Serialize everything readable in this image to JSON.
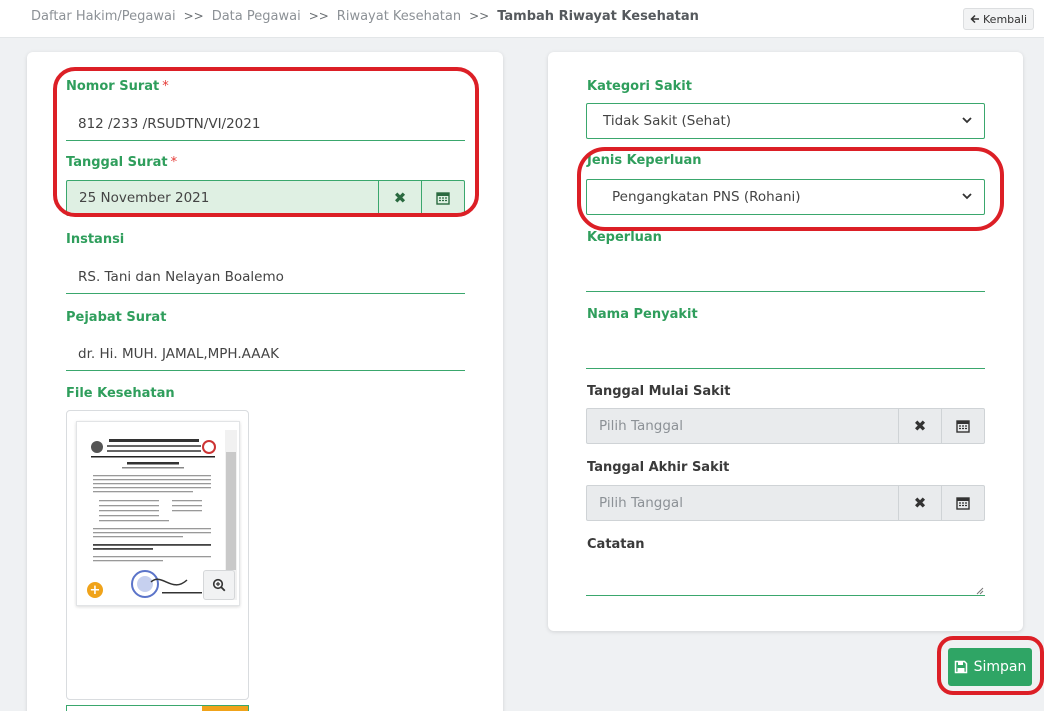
{
  "breadcrumb": {
    "items": [
      "Daftar Hakim/Pegawai",
      "Data Pegawai",
      "Riwayat Kesehatan"
    ],
    "separator": ">>",
    "current": "Tambah Riwayat Kesehatan"
  },
  "back_button": {
    "icon": "arrow-left-icon",
    "label": "Kembali"
  },
  "left_form": {
    "nomor_surat": {
      "label": "Nomor Surat",
      "required_mark": "*",
      "value": "812 /233 /RSUDTN/VI/2021"
    },
    "tanggal_surat": {
      "label": "Tanggal Surat",
      "required_mark": "*",
      "value": "25 November 2021"
    },
    "instansi": {
      "label": "Instansi",
      "value": "RS. Tani dan Nelayan Boalemo"
    },
    "pejabat_surat": {
      "label": "Pejabat Surat",
      "value": "dr. Hi. MUH. JAMAL,MPH.AAAK"
    },
    "file_kesehatan": {
      "label": "File Kesehatan"
    }
  },
  "right_form": {
    "kategori_sakit": {
      "label": "Kategori Sakit",
      "value": "Tidak Sakit (Sehat)"
    },
    "jenis_keperluan": {
      "label": "Jenis Keperluan",
      "value": "Pengangkatan PNS (Rohani)"
    },
    "keperluan": {
      "label": "Keperluan",
      "value": ""
    },
    "nama_penyakit": {
      "label": "Nama Penyakit",
      "value": ""
    },
    "tanggal_mulai_sakit": {
      "label": "Tanggal Mulai Sakit",
      "placeholder": "Pilih Tanggal"
    },
    "tanggal_akhir_sakit": {
      "label": "Tanggal Akhir Sakit",
      "placeholder": "Pilih Tanggal"
    },
    "catatan": {
      "label": "Catatan",
      "value": ""
    }
  },
  "save_button": {
    "icon": "floppy-disk-icon",
    "label": "Simpan"
  },
  "colors": {
    "accent": "#2fa565",
    "annotation": "#dc1f26",
    "required": "#e53935",
    "file_badge": "#f0a31a"
  }
}
